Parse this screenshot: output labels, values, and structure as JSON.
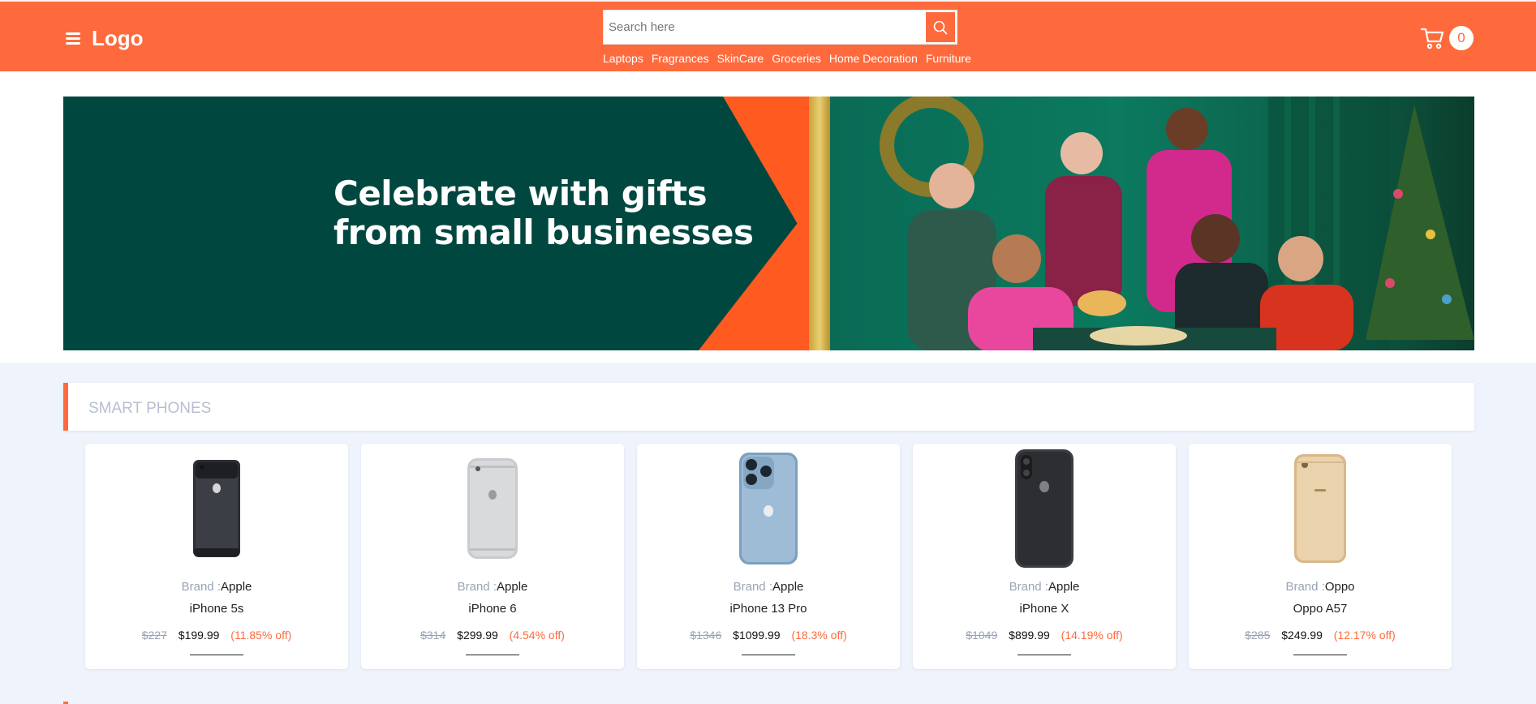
{
  "header": {
    "logo": "Logo",
    "search_placeholder": "Search here",
    "categories": [
      "Laptops",
      "Fragrances",
      "SkinCare",
      "Groceries",
      "Home Decoration",
      "Furniture"
    ],
    "cart_count": "0",
    "brand_color": "#ff6a3d"
  },
  "banner": {
    "line1": "Celebrate with gifts",
    "line2": "from small businesses"
  },
  "section": {
    "title": "SMART PHONES",
    "brand_label": "Brand :",
    "products": [
      {
        "brand": "Apple",
        "title": "iPhone 5s",
        "old_price": "$227",
        "price": "$199.99",
        "discount": "(11.85% off)"
      },
      {
        "brand": "Apple",
        "title": "iPhone 6",
        "old_price": "$314",
        "price": "$299.99",
        "discount": "(4.54% off)"
      },
      {
        "brand": "Apple",
        "title": "iPhone 13 Pro",
        "old_price": "$1346",
        "price": "$1099.99",
        "discount": "(18.3% off)"
      },
      {
        "brand": "Apple",
        "title": "iPhone X",
        "old_price": "$1049",
        "price": "$899.99",
        "discount": "(14.19% off)"
      },
      {
        "brand": "Oppo",
        "title": "Oppo A57",
        "old_price": "$285",
        "price": "$249.99",
        "discount": "(12.17% off)"
      }
    ]
  },
  "icons": [
    "menu-icon",
    "search-icon",
    "cart-icon"
  ]
}
